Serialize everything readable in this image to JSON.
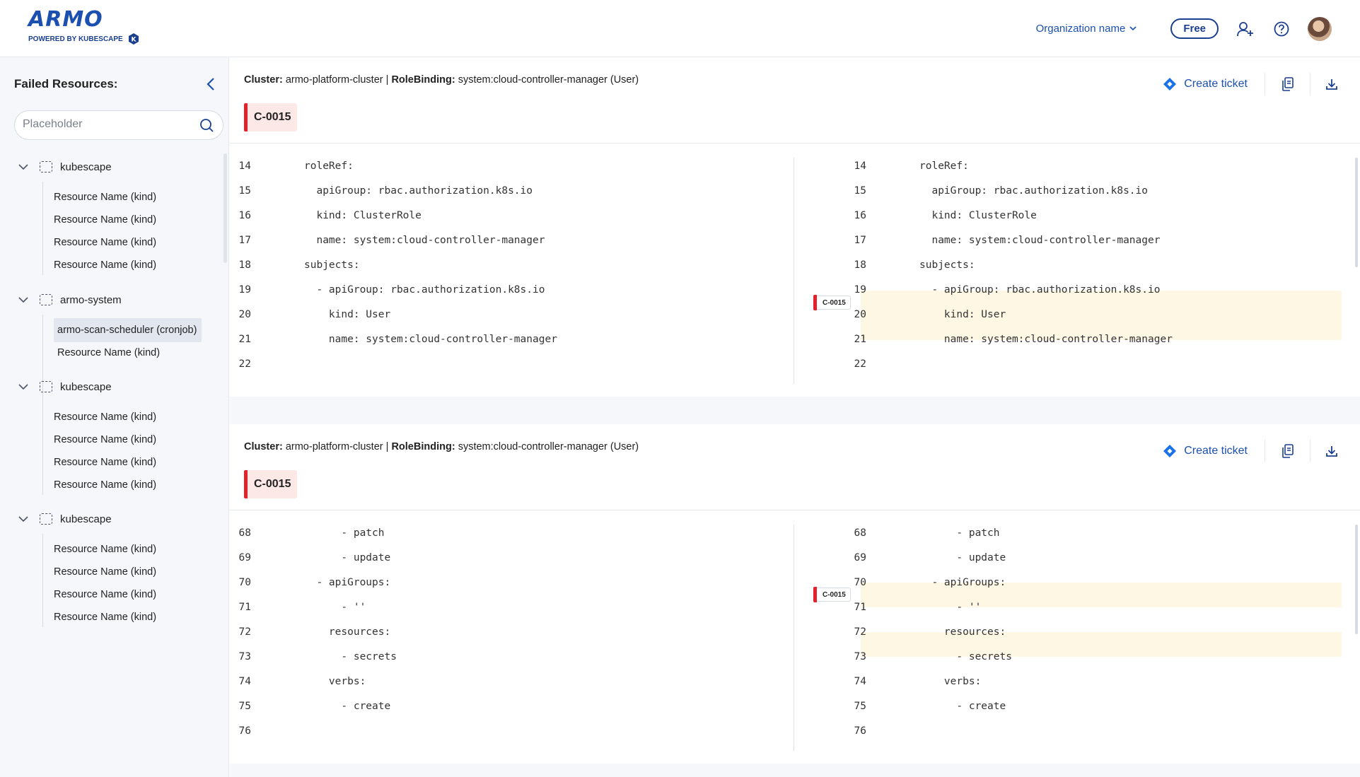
{
  "header": {
    "logo_main": "ARMO",
    "logo_sub": "POWERED BY KUBESCAPE",
    "org_name": "Organization name",
    "plan_label": "Free"
  },
  "sidebar": {
    "title": "Failed Resources:",
    "search_placeholder": "Placeholder",
    "groups": [
      {
        "name": "kubescape",
        "items": [
          "Resource Name (kind)",
          "Resource Name (kind)",
          "Resource Name (kind)",
          "Resource Name (kind)"
        ]
      },
      {
        "name": "armo-system",
        "items": [
          "armo-scan-scheduler (cronjob)",
          "Resource Name (kind)"
        ]
      },
      {
        "name": "kubescape",
        "items": [
          "Resource Name (kind)",
          "Resource Name (kind)",
          "Resource Name (kind)",
          "Resource Name (kind)"
        ]
      },
      {
        "name": "kubescape",
        "items": [
          "Resource Name (kind)",
          "Resource Name (kind)",
          "Resource Name (kind)",
          "Resource Name (kind)"
        ]
      }
    ]
  },
  "panels": [
    {
      "cluster_label": "Cluster:",
      "cluster_value": "armo-platform-cluster",
      "sep": "|",
      "binding_label": "RoleBinding:",
      "binding_value": "system:cloud-controller-manager (User)",
      "control_id": "C-0015",
      "create_ticket": "Create ticket",
      "mini_tag": "C-0015",
      "lines": [
        {
          "n": "14",
          "t": "roleRef:"
        },
        {
          "n": "15",
          "t": "  apiGroup: rbac.authorization.k8s.io"
        },
        {
          "n": "16",
          "t": "  kind: ClusterRole"
        },
        {
          "n": "17",
          "t": "  name: system:cloud-controller-manager"
        },
        {
          "n": "18",
          "t": "subjects:"
        },
        {
          "n": "19",
          "t": "  - apiGroup: rbac.authorization.k8s.io"
        },
        {
          "n": "20",
          "t": "    kind: User"
        },
        {
          "n": "21",
          "t": "    name: system:cloud-controller-manager"
        },
        {
          "n": "22",
          "t": ""
        }
      ]
    },
    {
      "cluster_label": "Cluster:",
      "cluster_value": "armo-platform-cluster",
      "sep": "|",
      "binding_label": "RoleBinding:",
      "binding_value": "system:cloud-controller-manager (User)",
      "control_id": "C-0015",
      "create_ticket": "Create ticket",
      "mini_tag": "C-0015",
      "lines": [
        {
          "n": "68",
          "t": "      - patch"
        },
        {
          "n": "69",
          "t": "      - update"
        },
        {
          "n": "70",
          "t": "  - apiGroups:"
        },
        {
          "n": "71",
          "t": "      - ''"
        },
        {
          "n": "72",
          "t": "    resources:"
        },
        {
          "n": "73",
          "t": "      - secrets"
        },
        {
          "n": "74",
          "t": "    verbs:"
        },
        {
          "n": "75",
          "t": "      - create"
        },
        {
          "n": "76",
          "t": ""
        }
      ]
    }
  ]
}
